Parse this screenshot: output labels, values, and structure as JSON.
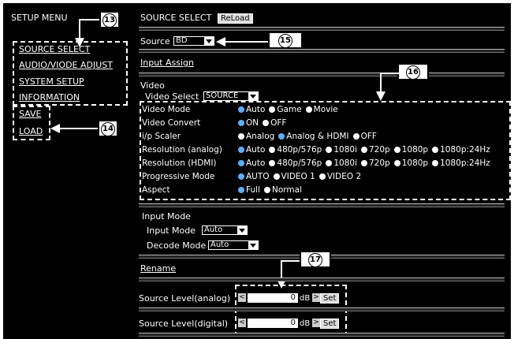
{
  "left_menu": {
    "title": "SETUP MENU",
    "items": [
      "SOURCE SELECT",
      "AUDIO/VIODE ADJUST",
      "SYSTEM SETUP",
      "INFORMATION"
    ],
    "save": "SAVE",
    "load": "LOAD"
  },
  "callouts": {
    "c13": "13",
    "c14": "14",
    "c15": "15",
    "c16": "16",
    "c17": "17"
  },
  "header": {
    "title": "SOURCE SELECT",
    "reload": "ReLoad"
  },
  "source": {
    "label": "Source",
    "value": "BD"
  },
  "input_assign": "Input Assign",
  "video": {
    "label": "Video",
    "select_label": "Video Select",
    "select_value": "SOURCE",
    "rows": [
      {
        "label": "Video Mode",
        "options": [
          {
            "t": "Auto",
            "on": true
          },
          {
            "t": "Game",
            "on": false
          },
          {
            "t": "Movie",
            "on": false
          }
        ]
      },
      {
        "label": "Video Convert",
        "options": [
          {
            "t": "ON",
            "on": true
          },
          {
            "t": "OFF",
            "on": false
          }
        ]
      },
      {
        "label": "i/p Scaler",
        "options": [
          {
            "t": "Analog",
            "on": false
          },
          {
            "t": "Analog & HDMI",
            "on": true
          },
          {
            "t": "OFF",
            "on": false
          }
        ]
      },
      {
        "label": "Resolution (analog)",
        "options": [
          {
            "t": "Auto",
            "on": true
          },
          {
            "t": "480p/576p",
            "on": false
          },
          {
            "t": "1080i",
            "on": false
          },
          {
            "t": "720p",
            "on": false
          },
          {
            "t": "1080p",
            "on": false
          },
          {
            "t": "1080p:24Hz",
            "on": false
          }
        ]
      },
      {
        "label": "Resolution (HDMI)",
        "options": [
          {
            "t": "Auto",
            "on": true
          },
          {
            "t": "480p/576p",
            "on": false
          },
          {
            "t": "1080i",
            "on": false
          },
          {
            "t": "720p",
            "on": false
          },
          {
            "t": "1080p",
            "on": false
          },
          {
            "t": "1080p:24Hz",
            "on": false
          }
        ]
      },
      {
        "label": "Progressive Mode",
        "options": [
          {
            "t": "AUTO",
            "on": true
          },
          {
            "t": "VIDEO 1",
            "on": false
          },
          {
            "t": "VIDEO 2",
            "on": false
          }
        ]
      },
      {
        "label": "Aspect",
        "options": [
          {
            "t": "Full",
            "on": true
          },
          {
            "t": "Normal",
            "on": false
          }
        ]
      }
    ]
  },
  "input_mode": {
    "section": "Input Mode",
    "mode_label": "Input Mode",
    "mode_value": "Auto",
    "decode_label": "Decode Mode",
    "decode_value": "Auto"
  },
  "rename": "Rename",
  "levels": [
    {
      "label": "Source Level(analog)",
      "value": "0",
      "unit": "dB",
      "set": "Set"
    },
    {
      "label": "Source Level(digital)",
      "value": "0",
      "unit": "dB",
      "set": "Set"
    }
  ]
}
